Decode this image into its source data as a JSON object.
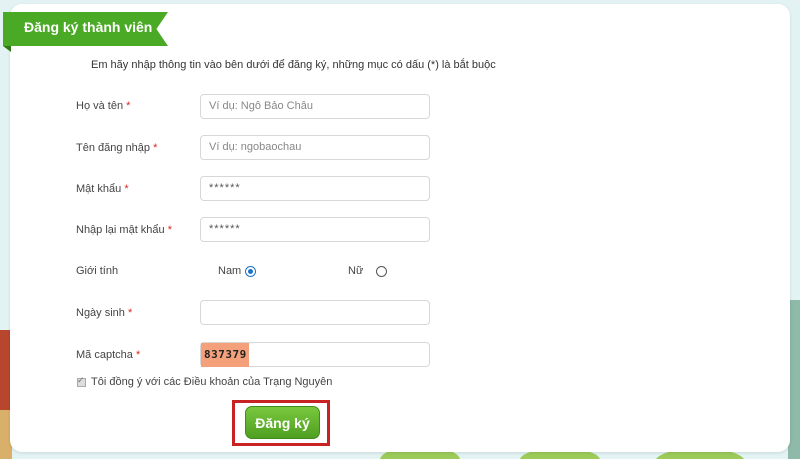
{
  "header": {
    "title": "Đăng ký thành viên"
  },
  "instruction": "Em hãy nhập thông tin vào bên dưới để đăng ký, những mục có dấu (*) là bắt buộc",
  "required_mark": "*",
  "fields": {
    "full_name": {
      "label": "Họ và tên",
      "placeholder": "Ví dụ: Ngô Bảo Châu"
    },
    "username": {
      "label": "Tên đăng nhập",
      "placeholder": "Ví dụ: ngobaochau"
    },
    "password": {
      "label": "Mật khẩu",
      "value": "******"
    },
    "confirm_password": {
      "label": "Nhập lại mật khẩu",
      "value": "******"
    },
    "gender": {
      "label": "Giới tính",
      "options": [
        "Nam",
        "Nữ"
      ],
      "selected": "Nam"
    },
    "birthday": {
      "label": "Ngày sinh",
      "value": ""
    },
    "captcha": {
      "label": "Mã captcha",
      "code": "837379",
      "value": ""
    }
  },
  "agreement": {
    "text": "Tôi đồng ý với các Điều khoản của Trạng Nguyên",
    "checked": true
  },
  "submit": {
    "label": "Đăng ký"
  },
  "colors": {
    "accent": "#4aaa26",
    "required": "#d9261c",
    "highlight": "#c92222",
    "captcha_bg": "#f3a07b"
  }
}
